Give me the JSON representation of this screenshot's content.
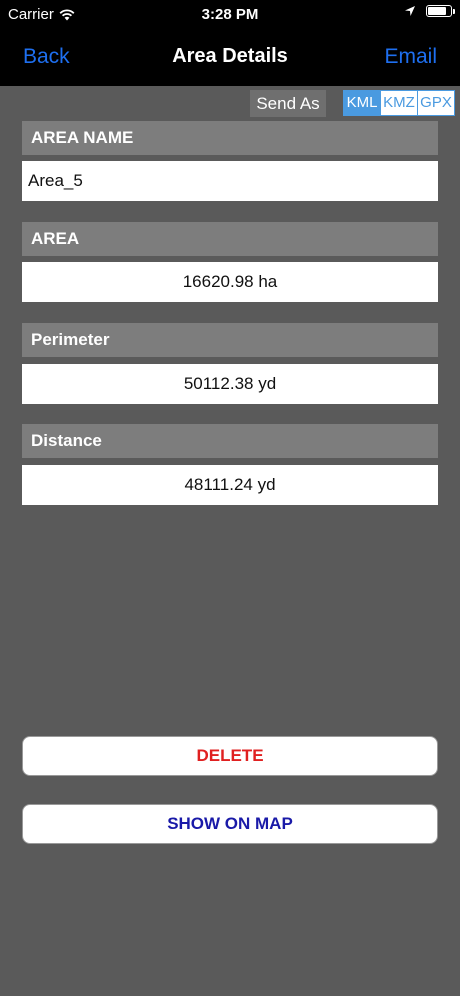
{
  "status_bar": {
    "carrier": "Carrier",
    "time": "3:28 PM"
  },
  "nav": {
    "back": "Back",
    "title": "Area Details",
    "email": "Email"
  },
  "send_as": {
    "label": "Send As",
    "options": [
      "KML",
      "KMZ",
      "GPX"
    ],
    "selected": "KML"
  },
  "fields": {
    "area_name": {
      "header": "AREA NAME",
      "value": "Area_5"
    },
    "area": {
      "header": "AREA",
      "value": "16620.98 ha"
    },
    "perimeter": {
      "header": "Perimeter",
      "value": "50112.38 yd"
    },
    "distance": {
      "header": "Distance",
      "value": "48111.24 yd"
    }
  },
  "buttons": {
    "delete": "DELETE",
    "show_on_map": "SHOW ON MAP"
  },
  "colors": {
    "accent": "#1e6ff0",
    "segment": "#4a9ae0",
    "delete": "#e02020",
    "map": "#1a1aa8"
  }
}
